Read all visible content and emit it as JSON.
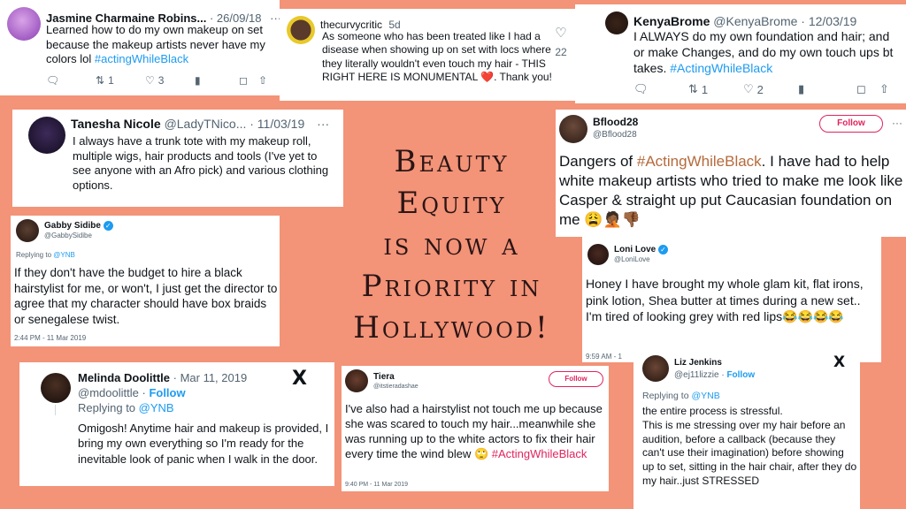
{
  "title": {
    "line1": "Beauty",
    "line2": "Equity",
    "line3": "is now a",
    "line4": "Priority in",
    "line5": "Hollywood!"
  },
  "colors": {
    "background": "#f39378",
    "hashtag_blue": "#1d9bf0",
    "follow_red": "#e0245e",
    "title_text": "#2a1515"
  },
  "tweets": {
    "jasmine": {
      "name": "Jasmine Charmaine Robins...",
      "date": "· 26/09/18",
      "text": "Learned how to do my own makeup on set because the makeup artists never have my colors lol ",
      "tag": "#actingWhileBlack",
      "retweets": "1",
      "likes": "3",
      "more": "···"
    },
    "curvy": {
      "name": "thecurvycritic",
      "date": "5d",
      "text": "As someone who has been treated like I had a disease when showing up on set with locs where they literally wouldn't even touch my hair - THIS RIGHT HERE IS MONUMENTAL ❤️. Thank you!",
      "likes": "22"
    },
    "kenya": {
      "name": "KenyaBrome",
      "handle": "@KenyaBrome · 12/03/19",
      "text": "I ALWAYS do my own foundation and hair; and or make Changes, and do my own touch ups bt takes. ",
      "tag": "#ActingWhileBlack",
      "retweets": "1",
      "likes": "2"
    },
    "tanesha": {
      "name": "Tanesha Nicole",
      "handle": "@LadyTNico... · 11/03/19",
      "more": "···",
      "text": "I always have a trunk tote with my makeup roll, multiple wigs, hair products and tools (I've yet to see anyone with an Afro pick) and various clothing options."
    },
    "bflood": {
      "name": "Bflood28",
      "handle": "@Bflood28",
      "follow": "Follow",
      "more": "···",
      "text_pre": "Dangers of ",
      "tag": "#ActingWhileBlack",
      "text_post": ". I have had to help white makeup artists who tried to make me look like Casper & straight up put Caucasian foundation on me 😩🤦🏾👎🏾"
    },
    "gabby": {
      "name": "Gabby Sidibe",
      "handle": "@GabbySidibe",
      "reply_label": "Replying to ",
      "reply_to": "@YNB",
      "text": "If they don't have the budget to hire a black hairstylist for me, or won't, I just get the director to agree that my character should have box braids or senegalese twist.",
      "time": "2:44 PM - 11 Mar 2019"
    },
    "loni": {
      "name": "Loni Love",
      "handle": "@LoniLove",
      "text": "Honey I have brought my whole glam kit,  flat irons, pink lotion, Shea butter at times during a new set.. I'm tired of looking grey with red lips😂😂😂😂",
      "time": "9:59 AM - 1"
    },
    "melinda": {
      "name": "Melinda Doolittle",
      "date": "· Mar 11, 2019",
      "handle": "@mdoolittle",
      "follow": "Follow",
      "reply_label": "Replying to ",
      "reply_to": "@YNB",
      "text": "Omigosh! Anytime hair and makeup is provided, I bring my own everything so I'm ready for the inevitable look of panic when I walk in the door.",
      "x": "X"
    },
    "tiera": {
      "name": "Tiera",
      "handle": "@itstieradashae",
      "follow": "Follow",
      "text": "I've also had a hairstylist not touch me up because she was scared to touch my hair...meanwhile she was running up to the white actors to fix their hair every time the wind blew 🙄 ",
      "tag": "#ActingWhileBlack",
      "time": "9:40 PM - 11 Mar 2019"
    },
    "liz": {
      "name": "Liz Jenkins",
      "handle": "@ej11lizzie · ",
      "follow": "Follow",
      "reply_label": "Replying to ",
      "reply_to": "@YNB",
      "text": "the entire process is stressful.\nThis is me stressing over my hair before an audition, before a callback (because they can't use their imagination) before showing up to set, sitting in the hair chair, after they do my hair..just STRESSED",
      "x": "X"
    }
  }
}
